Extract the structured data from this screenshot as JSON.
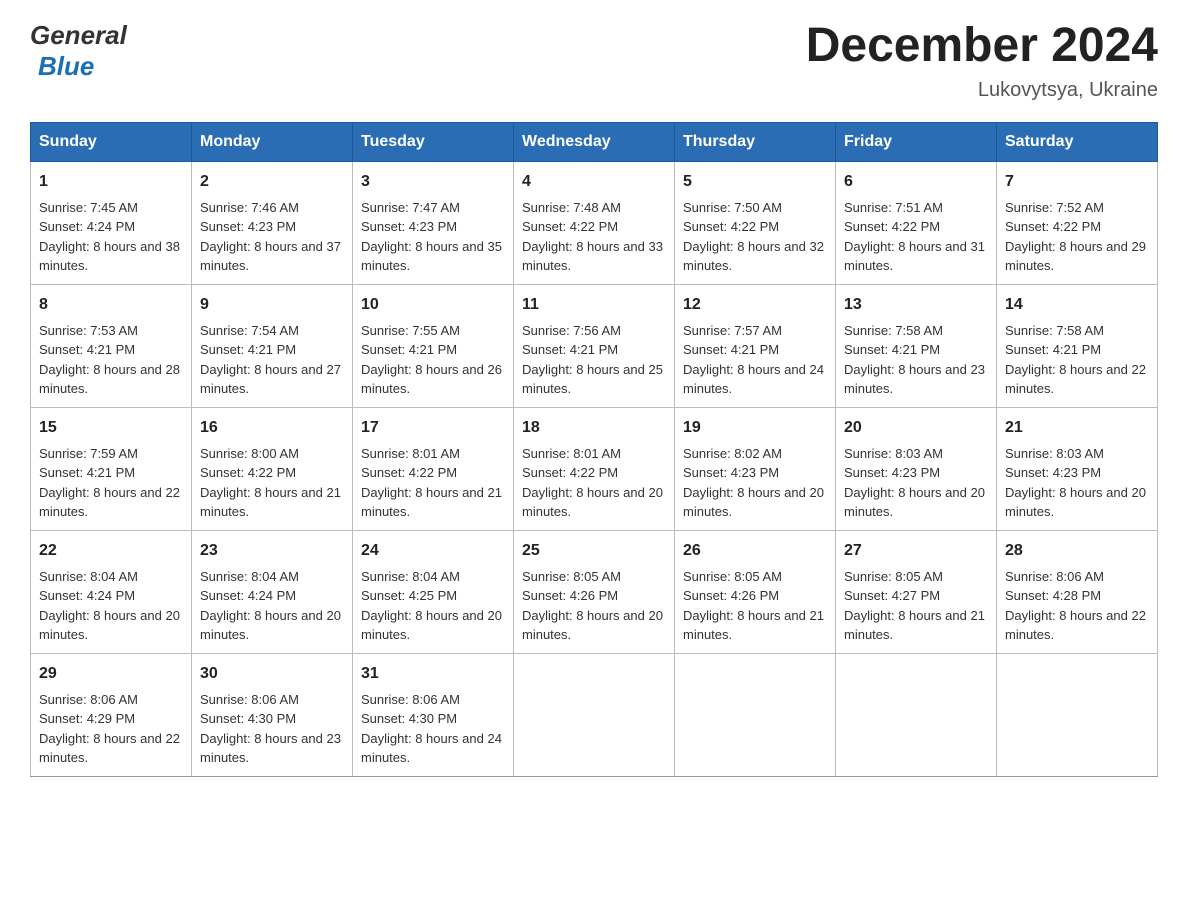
{
  "header": {
    "logo_general": "General",
    "logo_blue": "Blue",
    "title": "December 2024",
    "subtitle": "Lukovytsya, Ukraine"
  },
  "days_of_week": [
    "Sunday",
    "Monday",
    "Tuesday",
    "Wednesday",
    "Thursday",
    "Friday",
    "Saturday"
  ],
  "weeks": [
    [
      {
        "day": "1",
        "sunrise": "7:45 AM",
        "sunset": "4:24 PM",
        "daylight": "8 hours and 38 minutes."
      },
      {
        "day": "2",
        "sunrise": "7:46 AM",
        "sunset": "4:23 PM",
        "daylight": "8 hours and 37 minutes."
      },
      {
        "day": "3",
        "sunrise": "7:47 AM",
        "sunset": "4:23 PM",
        "daylight": "8 hours and 35 minutes."
      },
      {
        "day": "4",
        "sunrise": "7:48 AM",
        "sunset": "4:22 PM",
        "daylight": "8 hours and 33 minutes."
      },
      {
        "day": "5",
        "sunrise": "7:50 AM",
        "sunset": "4:22 PM",
        "daylight": "8 hours and 32 minutes."
      },
      {
        "day": "6",
        "sunrise": "7:51 AM",
        "sunset": "4:22 PM",
        "daylight": "8 hours and 31 minutes."
      },
      {
        "day": "7",
        "sunrise": "7:52 AM",
        "sunset": "4:22 PM",
        "daylight": "8 hours and 29 minutes."
      }
    ],
    [
      {
        "day": "8",
        "sunrise": "7:53 AM",
        "sunset": "4:21 PM",
        "daylight": "8 hours and 28 minutes."
      },
      {
        "day": "9",
        "sunrise": "7:54 AM",
        "sunset": "4:21 PM",
        "daylight": "8 hours and 27 minutes."
      },
      {
        "day": "10",
        "sunrise": "7:55 AM",
        "sunset": "4:21 PM",
        "daylight": "8 hours and 26 minutes."
      },
      {
        "day": "11",
        "sunrise": "7:56 AM",
        "sunset": "4:21 PM",
        "daylight": "8 hours and 25 minutes."
      },
      {
        "day": "12",
        "sunrise": "7:57 AM",
        "sunset": "4:21 PM",
        "daylight": "8 hours and 24 minutes."
      },
      {
        "day": "13",
        "sunrise": "7:58 AM",
        "sunset": "4:21 PM",
        "daylight": "8 hours and 23 minutes."
      },
      {
        "day": "14",
        "sunrise": "7:58 AM",
        "sunset": "4:21 PM",
        "daylight": "8 hours and 22 minutes."
      }
    ],
    [
      {
        "day": "15",
        "sunrise": "7:59 AM",
        "sunset": "4:21 PM",
        "daylight": "8 hours and 22 minutes."
      },
      {
        "day": "16",
        "sunrise": "8:00 AM",
        "sunset": "4:22 PM",
        "daylight": "8 hours and 21 minutes."
      },
      {
        "day": "17",
        "sunrise": "8:01 AM",
        "sunset": "4:22 PM",
        "daylight": "8 hours and 21 minutes."
      },
      {
        "day": "18",
        "sunrise": "8:01 AM",
        "sunset": "4:22 PM",
        "daylight": "8 hours and 20 minutes."
      },
      {
        "day": "19",
        "sunrise": "8:02 AM",
        "sunset": "4:23 PM",
        "daylight": "8 hours and 20 minutes."
      },
      {
        "day": "20",
        "sunrise": "8:03 AM",
        "sunset": "4:23 PM",
        "daylight": "8 hours and 20 minutes."
      },
      {
        "day": "21",
        "sunrise": "8:03 AM",
        "sunset": "4:23 PM",
        "daylight": "8 hours and 20 minutes."
      }
    ],
    [
      {
        "day": "22",
        "sunrise": "8:04 AM",
        "sunset": "4:24 PM",
        "daylight": "8 hours and 20 minutes."
      },
      {
        "day": "23",
        "sunrise": "8:04 AM",
        "sunset": "4:24 PM",
        "daylight": "8 hours and 20 minutes."
      },
      {
        "day": "24",
        "sunrise": "8:04 AM",
        "sunset": "4:25 PM",
        "daylight": "8 hours and 20 minutes."
      },
      {
        "day": "25",
        "sunrise": "8:05 AM",
        "sunset": "4:26 PM",
        "daylight": "8 hours and 20 minutes."
      },
      {
        "day": "26",
        "sunrise": "8:05 AM",
        "sunset": "4:26 PM",
        "daylight": "8 hours and 21 minutes."
      },
      {
        "day": "27",
        "sunrise": "8:05 AM",
        "sunset": "4:27 PM",
        "daylight": "8 hours and 21 minutes."
      },
      {
        "day": "28",
        "sunrise": "8:06 AM",
        "sunset": "4:28 PM",
        "daylight": "8 hours and 22 minutes."
      }
    ],
    [
      {
        "day": "29",
        "sunrise": "8:06 AM",
        "sunset": "4:29 PM",
        "daylight": "8 hours and 22 minutes."
      },
      {
        "day": "30",
        "sunrise": "8:06 AM",
        "sunset": "4:30 PM",
        "daylight": "8 hours and 23 minutes."
      },
      {
        "day": "31",
        "sunrise": "8:06 AM",
        "sunset": "4:30 PM",
        "daylight": "8 hours and 24 minutes."
      },
      null,
      null,
      null,
      null
    ]
  ],
  "labels": {
    "sunrise": "Sunrise:",
    "sunset": "Sunset:",
    "daylight": "Daylight:"
  }
}
